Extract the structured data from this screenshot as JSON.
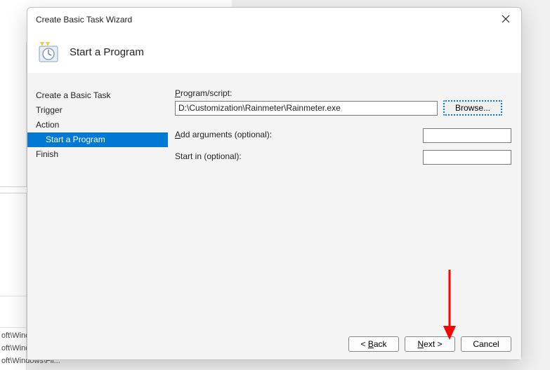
{
  "dialog": {
    "title": "Create Basic Task Wizard",
    "header_title": "Start a Program"
  },
  "sidebar": {
    "items": [
      {
        "label": "Create a Basic Task",
        "indent": false,
        "selected": false
      },
      {
        "label": "Trigger",
        "indent": false,
        "selected": false
      },
      {
        "label": "Action",
        "indent": false,
        "selected": false
      },
      {
        "label": "Start a Program",
        "indent": true,
        "selected": true
      },
      {
        "label": "Finish",
        "indent": false,
        "selected": false
      }
    ]
  },
  "form": {
    "program_label_pre": "P",
    "program_label_rest": "rogram/script:",
    "program_value": "D:\\Customization\\Rainmeter\\Rainmeter.exe",
    "browse_label_pre": "B",
    "browse_label_rest": "rowse...",
    "args_label_pre": "A",
    "args_label_rest": "dd arguments (optional):",
    "args_value": "",
    "startin_label": "Start in (optional):",
    "startin_value": ""
  },
  "footer": {
    "back_pre": "< ",
    "back_ul": "B",
    "back_rest": "ack",
    "next_ul": "N",
    "next_rest": "ext >",
    "cancel": "Cancel"
  },
  "bg": {
    "rows": [
      "oft\\Windo...",
      "oft\\Windows\\U...",
      "oft\\Windows\\Fli..."
    ]
  },
  "colors": {
    "accent": "#0078d4",
    "arrow": "#ff0000"
  }
}
